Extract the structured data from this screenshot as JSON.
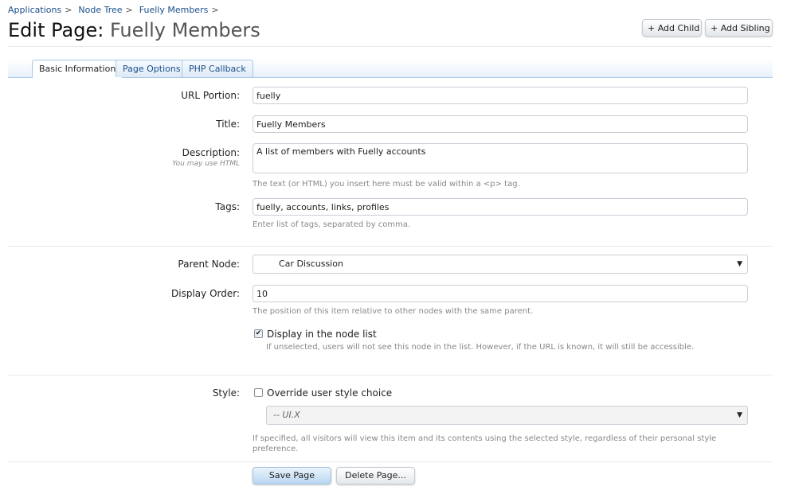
{
  "breadcrumb": [
    {
      "label": "Applications",
      "sep": ">"
    },
    {
      "label": "Node Tree",
      "sep": ">"
    },
    {
      "label": "Fuelly Members",
      "sep": ">"
    }
  ],
  "header": {
    "title_prefix": "Edit Page:",
    "title_name": "Fuelly Members",
    "add_child": "+ Add Child",
    "add_sibling": "+ Add Sibling"
  },
  "tabs": [
    {
      "label": "Basic Information",
      "active": true
    },
    {
      "label": "Page Options",
      "active": false
    },
    {
      "label": "PHP Callback",
      "active": false
    }
  ],
  "form": {
    "url_portion": {
      "label": "URL Portion:",
      "value": "fuelly"
    },
    "title": {
      "label": "Title:",
      "value": "Fuelly Members"
    },
    "description": {
      "label": "Description:",
      "sublabel": "You may use HTML",
      "value": "A list of members with Fuelly accounts",
      "hint": "The text (or HTML) you insert here must be valid within a <p> tag."
    },
    "tags": {
      "label": "Tags:",
      "value": "fuelly, accounts, links, profiles",
      "hint": "Enter list of tags, separated by comma."
    },
    "parent_node": {
      "label": "Parent Node:",
      "selected": "Car Discussion"
    },
    "display_order": {
      "label": "Display Order:",
      "value": "10",
      "hint": "The position of this item relative to other nodes with the same parent."
    },
    "display_in_list": {
      "label": "Display in the node list",
      "checked": true,
      "hint": "If unselected, users will not see this node in the list. However, if the URL is known, it will still be accessible."
    },
    "style": {
      "label": "Style:",
      "override_label": "Override user style choice",
      "checked": false,
      "selected": "-- UI.X",
      "hint": "If specified, all visitors will view this item and its contents using the selected style, regardless of their personal style preference."
    }
  },
  "actions": {
    "save": "Save Page",
    "delete": "Delete Page..."
  },
  "icons": {
    "checkmark": "✔",
    "dropdown": "▼"
  }
}
